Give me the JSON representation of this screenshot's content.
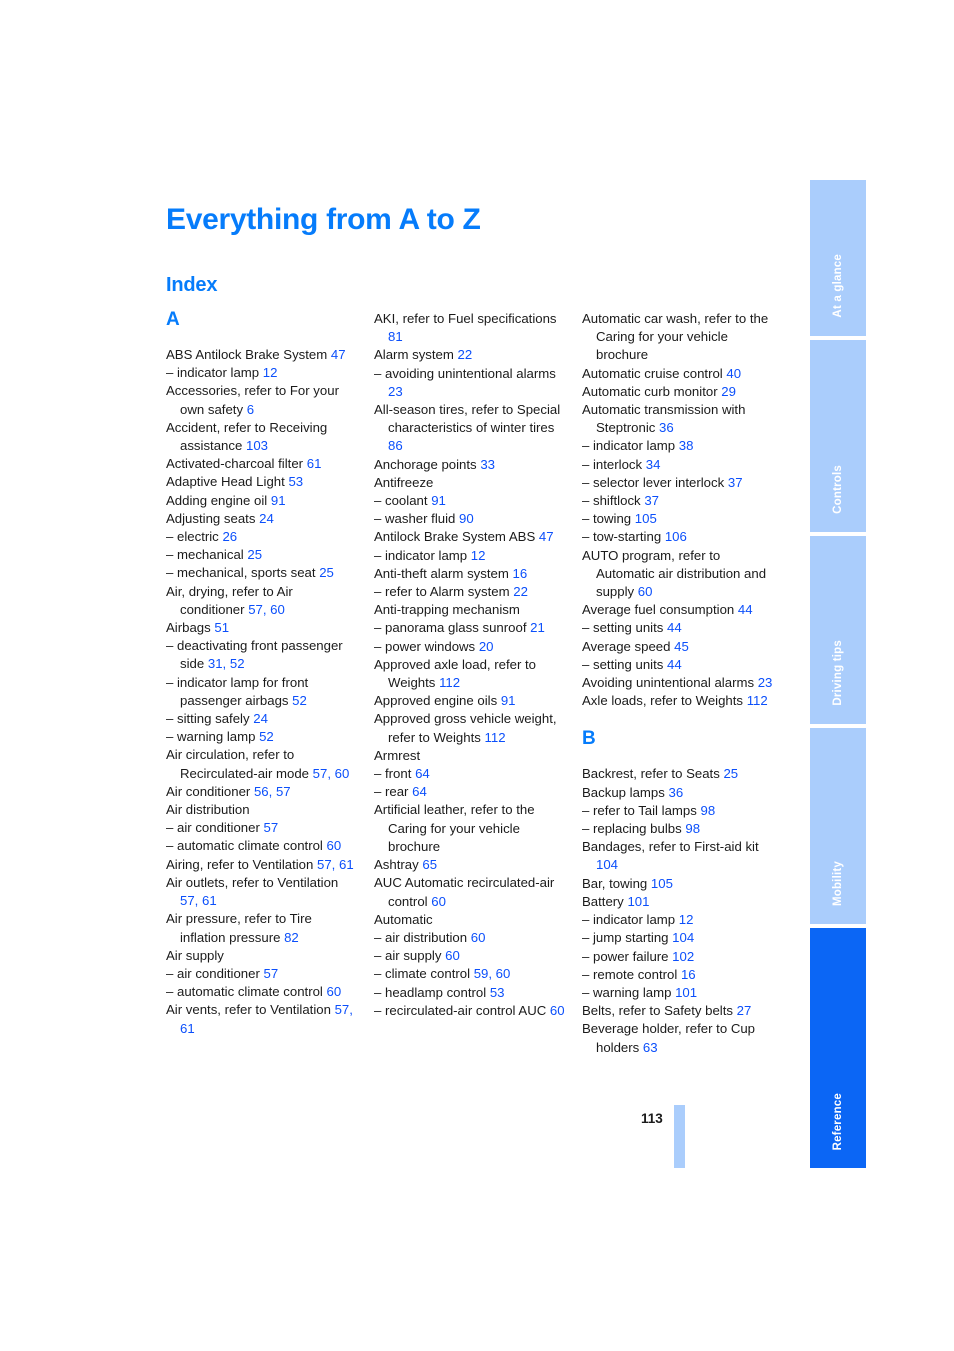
{
  "document": {
    "title": "Everything from A to Z",
    "section": "Index",
    "page_number": "113"
  },
  "tabs": [
    {
      "label": "At a glance",
      "active": false
    },
    {
      "label": "Controls",
      "active": false
    },
    {
      "label": "Driving tips",
      "active": false
    },
    {
      "label": "Mobility",
      "active": false
    },
    {
      "label": "Reference",
      "active": true
    }
  ],
  "columns": [
    {
      "letter": "A",
      "entries": [
        {
          "type": "main",
          "text": "ABS Antilock Brake System ",
          "pages": "47"
        },
        {
          "type": "sub",
          "text": "– indicator lamp ",
          "pages": "12"
        },
        {
          "type": "main",
          "text": "Accessories, refer to For your own safety ",
          "pages": "6"
        },
        {
          "type": "main",
          "text": "Accident, refer to Receiving assistance ",
          "pages": "103"
        },
        {
          "type": "main",
          "text": "Activated-charcoal filter ",
          "pages": "61"
        },
        {
          "type": "main",
          "text": "Adaptive Head Light ",
          "pages": "53"
        },
        {
          "type": "main",
          "text": "Adding engine oil ",
          "pages": "91"
        },
        {
          "type": "main",
          "text": "Adjusting seats ",
          "pages": "24"
        },
        {
          "type": "sub",
          "text": "– electric ",
          "pages": "26"
        },
        {
          "type": "sub",
          "text": "– mechanical ",
          "pages": "25"
        },
        {
          "type": "sub",
          "text": "– mechanical, sports seat ",
          "pages": "25"
        },
        {
          "type": "main",
          "text": "Air, drying, refer to Air conditioner ",
          "pages": "57, 60"
        },
        {
          "type": "main",
          "text": "Airbags ",
          "pages": "51"
        },
        {
          "type": "sub",
          "text": "– deactivating front passenger side ",
          "pages": "31, 52"
        },
        {
          "type": "sub",
          "text": "– indicator lamp for front passenger airbags ",
          "pages": "52"
        },
        {
          "type": "sub",
          "text": "– sitting safely ",
          "pages": "24"
        },
        {
          "type": "sub",
          "text": "– warning lamp ",
          "pages": "52"
        },
        {
          "type": "main",
          "text": "Air circulation, refer to Recirculated-air mode ",
          "pages": "57, 60"
        },
        {
          "type": "main",
          "text": "Air conditioner ",
          "pages": "56, 57"
        },
        {
          "type": "main",
          "text": "Air distribution",
          "pages": ""
        },
        {
          "type": "sub",
          "text": "– air conditioner ",
          "pages": "57"
        },
        {
          "type": "sub",
          "text": "– automatic climate control ",
          "pages": "60"
        },
        {
          "type": "main",
          "text": "Airing, refer to Ventilation ",
          "pages": "57, 61"
        },
        {
          "type": "main",
          "text": "Air outlets, refer to Ventilation ",
          "pages": "57, 61"
        },
        {
          "type": "main",
          "text": "Air pressure, refer to Tire inflation pressure ",
          "pages": "82"
        },
        {
          "type": "main",
          "text": "Air supply",
          "pages": ""
        },
        {
          "type": "sub",
          "text": "– air conditioner ",
          "pages": "57"
        },
        {
          "type": "sub",
          "text": "– automatic climate control ",
          "pages": "60"
        },
        {
          "type": "main",
          "text": "Air vents, refer to Ventilation ",
          "pages": "57, 61"
        }
      ]
    },
    {
      "letter": "",
      "entries": [
        {
          "type": "main",
          "text": "AKI, refer to Fuel specifications ",
          "pages": "81"
        },
        {
          "type": "main",
          "text": "Alarm system ",
          "pages": "22"
        },
        {
          "type": "sub",
          "text": "– avoiding unintentional alarms ",
          "pages": "23"
        },
        {
          "type": "main",
          "text": "All-season tires, refer to Special characteristics of winter tires ",
          "pages": "86"
        },
        {
          "type": "main",
          "text": "Anchorage points ",
          "pages": "33"
        },
        {
          "type": "main",
          "text": "Antifreeze",
          "pages": ""
        },
        {
          "type": "sub",
          "text": "– coolant ",
          "pages": "91"
        },
        {
          "type": "sub",
          "text": "– washer fluid ",
          "pages": "90"
        },
        {
          "type": "main",
          "text": "Antilock Brake System ABS ",
          "pages": "47"
        },
        {
          "type": "sub",
          "text": "– indicator lamp ",
          "pages": "12"
        },
        {
          "type": "main",
          "text": "Anti-theft alarm system ",
          "pages": "16"
        },
        {
          "type": "sub",
          "text": "– refer to Alarm system ",
          "pages": "22"
        },
        {
          "type": "main",
          "text": "Anti-trapping mechanism",
          "pages": ""
        },
        {
          "type": "sub",
          "text": "– panorama glass sunroof ",
          "pages": "21"
        },
        {
          "type": "sub",
          "text": "– power windows ",
          "pages": "20"
        },
        {
          "type": "main",
          "text": "Approved axle load, refer to Weights ",
          "pages": "112"
        },
        {
          "type": "main",
          "text": "Approved engine oils ",
          "pages": "91"
        },
        {
          "type": "main",
          "text": "Approved gross vehicle weight, refer to Weights ",
          "pages": "112"
        },
        {
          "type": "main",
          "text": "Armrest",
          "pages": ""
        },
        {
          "type": "sub",
          "text": "– front ",
          "pages": "64"
        },
        {
          "type": "sub",
          "text": "– rear ",
          "pages": "64"
        },
        {
          "type": "main",
          "text": "Artificial leather, refer to the Caring for your vehicle brochure",
          "pages": ""
        },
        {
          "type": "main",
          "text": "Ashtray ",
          "pages": "65"
        },
        {
          "type": "main",
          "text": "AUC Automatic recirculated-air control ",
          "pages": "60"
        },
        {
          "type": "main",
          "text": "Automatic",
          "pages": ""
        },
        {
          "type": "sub",
          "text": "– air distribution ",
          "pages": "60"
        },
        {
          "type": "sub",
          "text": "– air supply ",
          "pages": "60"
        },
        {
          "type": "sub",
          "text": "– climate control ",
          "pages": "59, 60"
        },
        {
          "type": "sub",
          "text": "– headlamp control ",
          "pages": "53"
        },
        {
          "type": "sub",
          "text": "– recirculated-air control AUC ",
          "pages": "60"
        }
      ]
    },
    {
      "letter": "",
      "entries": [
        {
          "type": "main",
          "text": "Automatic car wash, refer to the Caring for your vehicle brochure",
          "pages": ""
        },
        {
          "type": "main",
          "text": "Automatic cruise control ",
          "pages": "40"
        },
        {
          "type": "main",
          "text": "Automatic curb monitor ",
          "pages": "29"
        },
        {
          "type": "main",
          "text": "Automatic transmission with Steptronic ",
          "pages": "36"
        },
        {
          "type": "sub",
          "text": "– indicator lamp ",
          "pages": "38"
        },
        {
          "type": "sub",
          "text": "– interlock ",
          "pages": "34"
        },
        {
          "type": "sub",
          "text": "– selector lever interlock ",
          "pages": "37"
        },
        {
          "type": "sub",
          "text": "– shiftlock ",
          "pages": "37"
        },
        {
          "type": "sub",
          "text": "– towing ",
          "pages": "105"
        },
        {
          "type": "sub",
          "text": "– tow-starting ",
          "pages": "106"
        },
        {
          "type": "main",
          "text": "AUTO program, refer to Automatic air distribution and supply ",
          "pages": "60"
        },
        {
          "type": "main",
          "text": "Average fuel consumption ",
          "pages": "44"
        },
        {
          "type": "sub",
          "text": "– setting units ",
          "pages": "44"
        },
        {
          "type": "main",
          "text": "Average speed ",
          "pages": "45"
        },
        {
          "type": "sub",
          "text": "– setting units ",
          "pages": "44"
        },
        {
          "type": "main",
          "text": "Avoiding unintentional alarms ",
          "pages": "23"
        },
        {
          "type": "main",
          "text": "Axle loads, refer to Weights ",
          "pages": "112"
        }
      ],
      "letter2": "B",
      "entries2": [
        {
          "type": "main",
          "text": "Backrest, refer to Seats ",
          "pages": "25"
        },
        {
          "type": "main",
          "text": "Backup lamps ",
          "pages": "36"
        },
        {
          "type": "sub",
          "text": "– refer to Tail lamps ",
          "pages": "98"
        },
        {
          "type": "sub",
          "text": "– replacing bulbs ",
          "pages": "98"
        },
        {
          "type": "main",
          "text": "Bandages, refer to First-aid kit ",
          "pages": "104"
        },
        {
          "type": "main",
          "text": "Bar, towing ",
          "pages": "105"
        },
        {
          "type": "main",
          "text": "Battery ",
          "pages": "101"
        },
        {
          "type": "sub",
          "text": "– indicator lamp ",
          "pages": "12"
        },
        {
          "type": "sub",
          "text": "– jump starting ",
          "pages": "104"
        },
        {
          "type": "sub",
          "text": "– power failure ",
          "pages": "102"
        },
        {
          "type": "sub",
          "text": "– remote control ",
          "pages": "16"
        },
        {
          "type": "sub",
          "text": "– warning lamp ",
          "pages": "101"
        },
        {
          "type": "main",
          "text": "Belts, refer to Safety belts ",
          "pages": "27"
        },
        {
          "type": "main",
          "text": "Beverage holder, refer to Cup holders ",
          "pages": "63"
        }
      ]
    }
  ],
  "colors": {
    "accent_blue": "#067cfb",
    "page_ref_blue": "#0b4ffb",
    "tab_inactive": "#aacdfc",
    "tab_active": "#0b66f5",
    "text": "#1b1b1b"
  }
}
